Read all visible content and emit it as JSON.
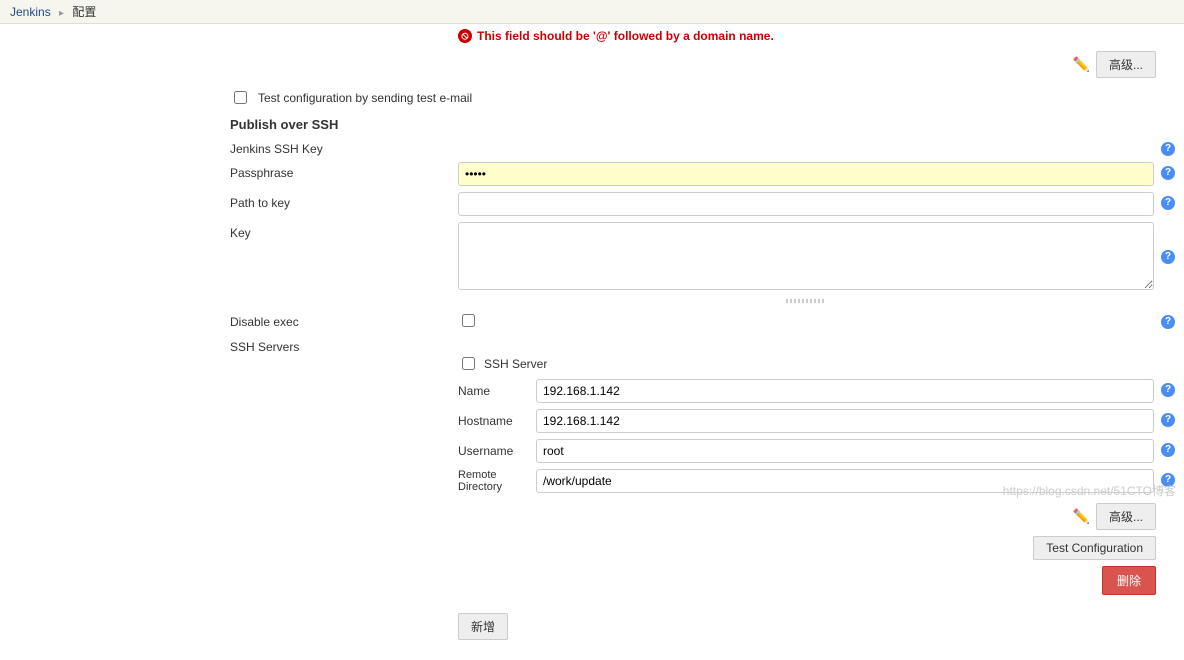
{
  "breadcrumb": {
    "root": "Jenkins",
    "current": "配置"
  },
  "error": {
    "message": "This field should be '@' followed by a domain name."
  },
  "buttons": {
    "advanced": "高级...",
    "add": "新增",
    "test_config": "Test Configuration",
    "delete": "删除"
  },
  "test_email": {
    "label": "Test configuration by sending test e-mail"
  },
  "section": {
    "publish_over_ssh": "Publish over SSH"
  },
  "labels": {
    "jenkins_ssh_key": "Jenkins SSH Key",
    "passphrase": "Passphrase",
    "path_to_key": "Path to key",
    "key": "Key",
    "disable_exec": "Disable exec",
    "ssh_servers": "SSH Servers",
    "ssh_server": "SSH Server",
    "name": "Name",
    "hostname": "Hostname",
    "username": "Username",
    "remote_directory": "Remote Directory"
  },
  "values": {
    "passphrase": "•••••",
    "path_to_key": "",
    "key": "",
    "name": "192.168.1.142",
    "hostname": "192.168.1.142",
    "username": "root",
    "remote_directory": "/work/update"
  },
  "icons": {
    "pencil": "✏️",
    "help": "?"
  },
  "watermark": "https://blog.csdn.net/51CTO博客"
}
